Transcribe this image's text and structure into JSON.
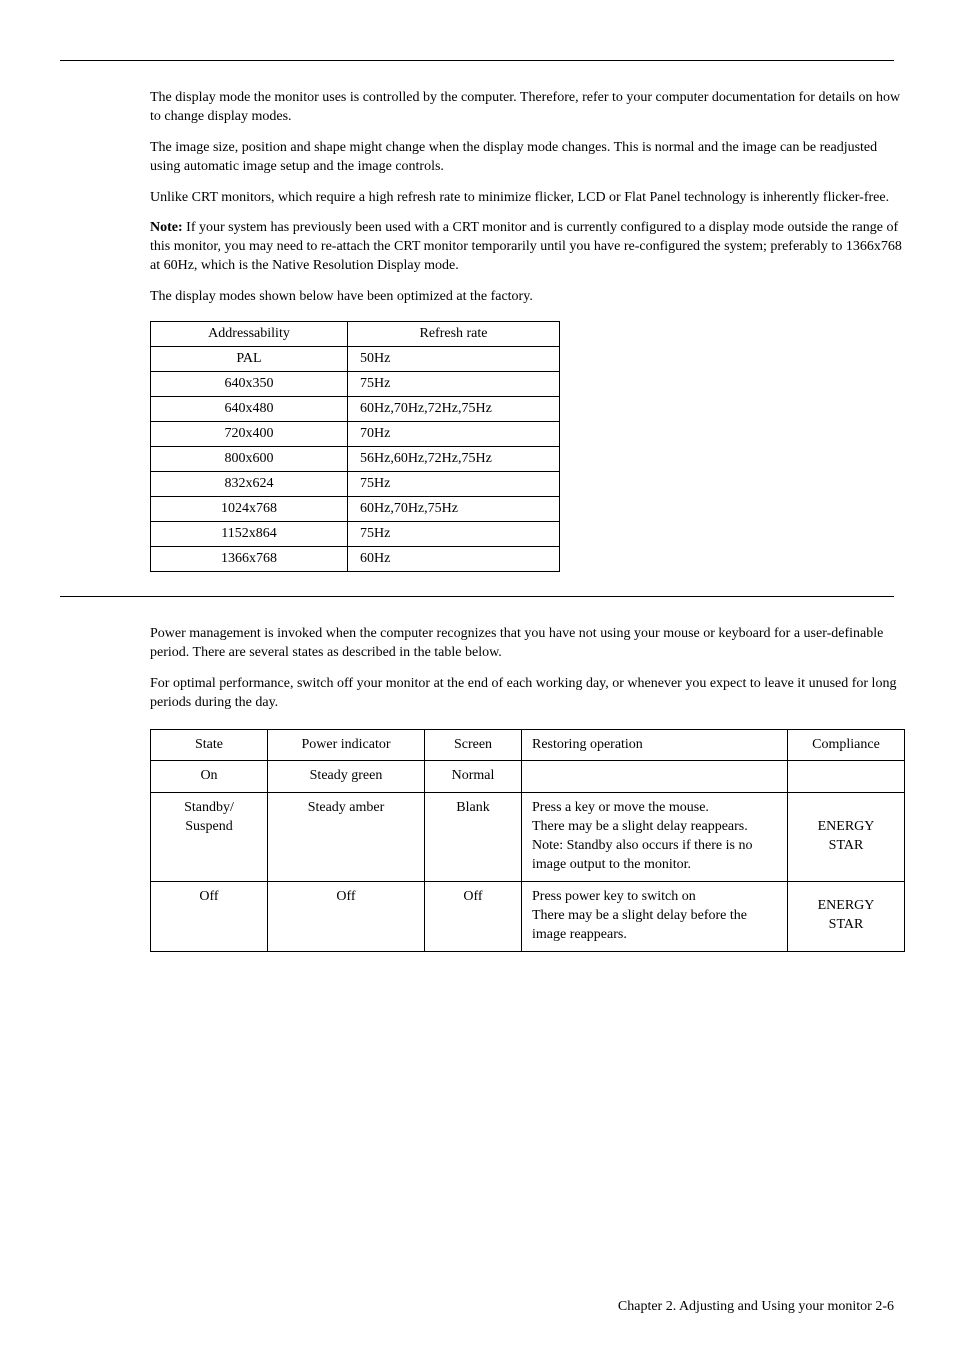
{
  "section1": {
    "p1": "The display mode the monitor uses is controlled by the computer. Therefore, refer to your computer documentation for details on how to change display modes.",
    "p2": "The image size, position and shape might change when the display mode changes. This is normal and the image can be readjusted using automatic image setup and the image controls.",
    "p3": "Unlike CRT monitors, which require a high refresh rate to minimize flicker, LCD or Flat Panel technology is inherently flicker-free.",
    "note_label": "Note:",
    "note_text": " If your system has previously been used with a CRT monitor and is currently configured to a display mode outside the range of this monitor, you may need to re-attach the CRT monitor temporarily until you have re-configured the system; preferably to 1366x768 at 60Hz, which is the Native Resolution Display mode.",
    "p5": "The display modes shown below have been optimized at the factory."
  },
  "table1": {
    "headers": {
      "addressability": "Addressability",
      "refresh": "Refresh rate"
    },
    "rows": [
      {
        "a": "PAL",
        "r": "50Hz"
      },
      {
        "a": "640x350",
        "r": "75Hz"
      },
      {
        "a": "640x480",
        "r": "60Hz,70Hz,72Hz,75Hz"
      },
      {
        "a": "720x400",
        "r": "70Hz"
      },
      {
        "a": "800x600",
        "r": "56Hz,60Hz,72Hz,75Hz"
      },
      {
        "a": "832x624",
        "r": "75Hz"
      },
      {
        "a": "1024x768",
        "r": "60Hz,70Hz,75Hz"
      },
      {
        "a": "1152x864",
        "r": "75Hz"
      },
      {
        "a": "1366x768",
        "r": "60Hz"
      }
    ]
  },
  "section2": {
    "p1": "Power management is invoked when the computer recognizes that you have not using   your mouse or keyboard for a user-definable period. There are several states as described in the table below.",
    "p2": "For optimal performance, switch off your monitor at the end of each working day, or whenever you expect to leave it unused for long periods during the day."
  },
  "table2": {
    "headers": {
      "state": "State",
      "power": "Power indicator",
      "screen": "Screen",
      "restore": "Restoring operation",
      "compliance": "Compliance"
    },
    "rows": [
      {
        "state": "On",
        "power": "Steady green",
        "screen": "Normal",
        "restore": "",
        "compliance": ""
      },
      {
        "state": "Standby/\nSuspend",
        "power": "Steady amber",
        "screen": "Blank",
        "restore": "Press a key or move the mouse.\nThere may be a slight delay reappears.\nNote: Standby also occurs if there is no image output to the monitor.",
        "compliance": "ENERGY\nSTAR"
      },
      {
        "state": "Off",
        "power": "Off",
        "screen": "Off",
        "restore": "Press power key to switch on\nThere may be a slight delay before the image reappears.",
        "compliance": "ENERGY\nSTAR"
      }
    ]
  },
  "footer": "Chapter 2. Adjusting and Using your monitor 2-6"
}
